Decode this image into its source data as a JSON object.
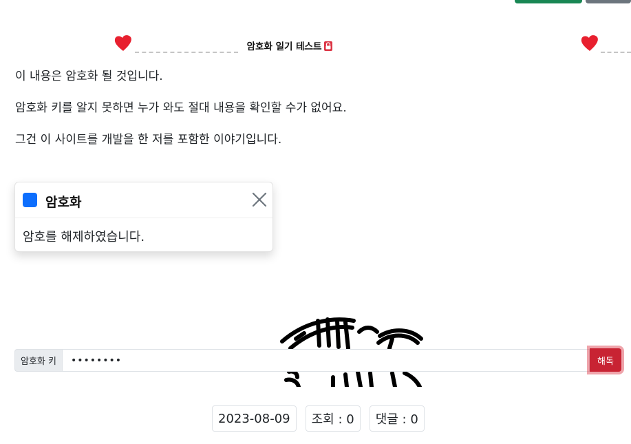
{
  "header": {
    "title": "암호화 일기 테스트",
    "lock_icon": "lock-icon",
    "heart_icon": "heart-icon"
  },
  "content": {
    "paragraphs": [
      "이 내용은 암호화 될 것입니다.",
      "암호화 키를 알지 못하면 누가 와도 절대 내용을 확인할 수가 없어요.",
      "그건 이 사이트를 개발을 한 저를 포함한 이야기입니다."
    ]
  },
  "toast": {
    "title": "암호화",
    "message": "암호를 해제하였습니다.",
    "accent": "#0d6efd"
  },
  "decrypt": {
    "label": "암호화 키",
    "value": "••••••••",
    "button_label": "해독"
  },
  "meta": {
    "date": "2023-08-09",
    "views": "조회 : 0",
    "comments": "댓글 : 0"
  },
  "colors": {
    "heart": "#e8202f",
    "danger": "#c82333",
    "primary": "#0d6efd",
    "success": "#198754",
    "secondary": "#6c757d"
  }
}
